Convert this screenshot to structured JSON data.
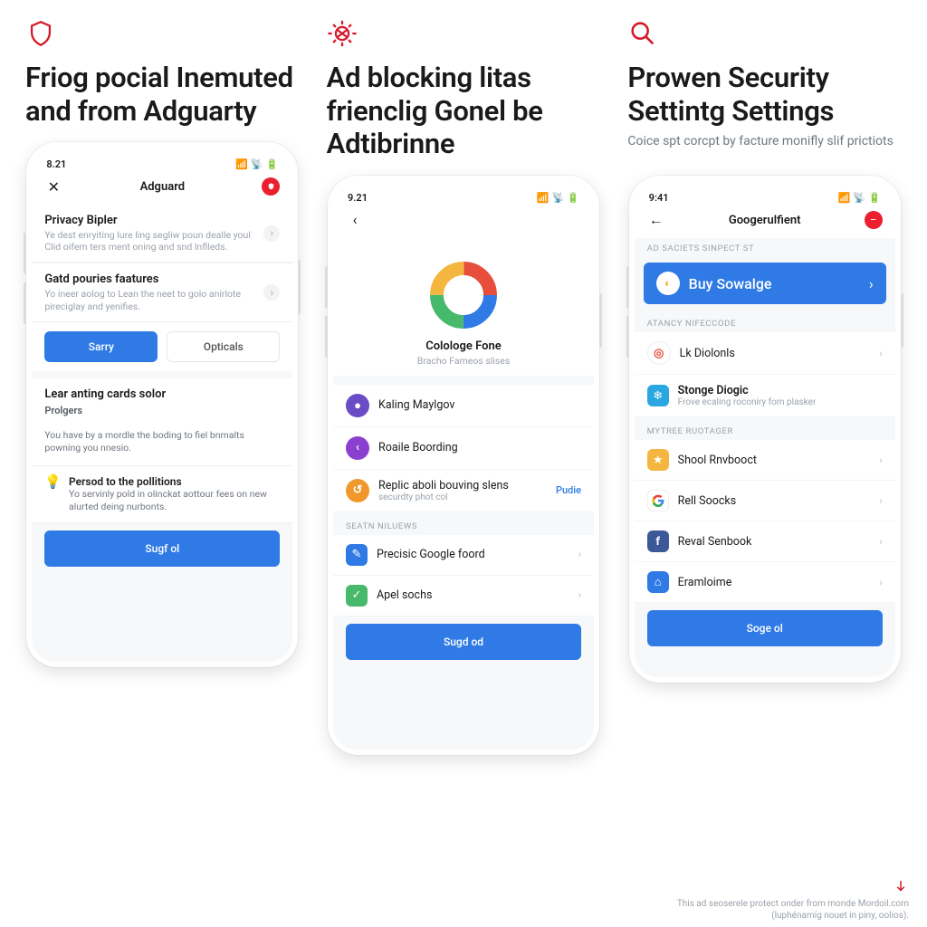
{
  "columns": [
    {
      "heading": "Friog pocial Inemuted and from Adguarty",
      "subheading": "",
      "phone": {
        "time": "8.21",
        "nav_title": "Adguard",
        "sections": [
          {
            "title": "Privacy Bipler",
            "desc": "Ye dest enryiting lure ling segliw poun dealle youl Clid oifem ters ment oning and snd lnflleds."
          },
          {
            "title": "Gatd pouries faatures",
            "desc": "Yo ineer aolog to Lean the neet to golo anirlote pireciglay and yenifies."
          }
        ],
        "buttons": {
          "primary": "Sarry",
          "secondary": "Opticals"
        },
        "group_title": "Lear anting cards solor",
        "group_sub": "Prolgers",
        "group_desc": "You have by a mordle the boding to fiel bnmalts powning you nnesio.",
        "tip_title": "Persod to the pollitions",
        "tip_desc": "Yo servinly pold in olinckat aottour fees on new alurted deing nurbonts.",
        "cta": "Sugf ol"
      }
    },
    {
      "heading": "Ad blocking litas frienclig Gonel be Adtibrinne",
      "subheading": "",
      "phone": {
        "time": "9.21",
        "donut_title": "Colologe Fone",
        "donut_sub": "Bracho Fameos slises",
        "items": [
          {
            "label": "Kaling Maylgov",
            "color": "#6a4cc6"
          },
          {
            "label": "Roaile Boording",
            "color": "#8a3fcf"
          },
          {
            "label": "Replic aboli bouving slens",
            "sub": "securdty phot col",
            "color": "#f0982c",
            "tail": "Pudie",
            "tail_link": true
          }
        ],
        "section_label": "Seatn niluews",
        "items2": [
          {
            "label": "Precisic Google foord",
            "color": "#2f7ae5",
            "glyph": "✎"
          },
          {
            "label": "Apel sochs",
            "color": "#46b96a",
            "glyph": "✓"
          }
        ],
        "cta": "Sugd od"
      }
    },
    {
      "heading": "Prowen Security Settintg Settings",
      "subheading": "Coice spt corcpt by facture monifly slif prictiots",
      "phone": {
        "time": "9:41",
        "nav_title": "Googerulfient",
        "top_label": "Ad saciets sinpect st",
        "highlight": "Buy Sowalge",
        "section1_label": "Atancy Nifeccode",
        "section1_items": [
          {
            "label": "Lk Diolonls",
            "color": "#e84e3c",
            "glyph": "◎"
          },
          {
            "label": "Stonge Diogic",
            "sub": "Frove ecaling roconiry fom plasker",
            "color": "#2aa7e0",
            "glyph": "❄"
          }
        ],
        "section2_label": "Mytree Ruotager",
        "section2_items": [
          {
            "label": "Shool Rnvbooct",
            "color": "#f4b63e",
            "glyph": "★"
          },
          {
            "label": "Rell Soocks",
            "google": true
          },
          {
            "label": "Reval Senbook",
            "color": "#3b5998",
            "glyph": "f"
          },
          {
            "label": "Eramloime",
            "color": "#2f7ae5",
            "glyph": "⌂"
          }
        ],
        "cta": "Soge ol"
      }
    }
  ],
  "footer": {
    "line1": "This ad seoserele protect onder from monde Mordoil.com",
    "line2": "(luphénamíg nouet in piny, oolios)."
  }
}
